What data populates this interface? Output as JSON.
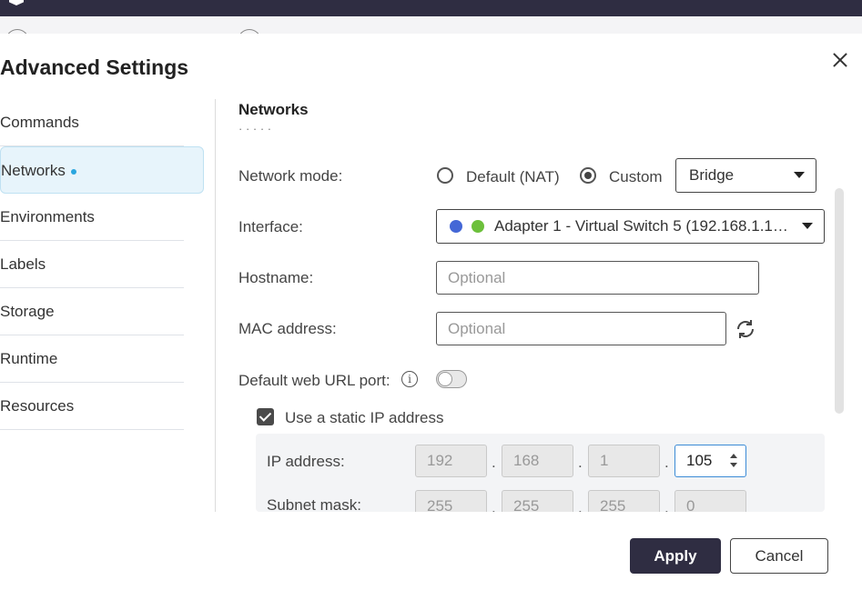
{
  "dialog": {
    "title": "Advanced Settings",
    "section_title": "Networks",
    "section_subtitle_cut": "· · · · ·"
  },
  "sidebar": {
    "items": [
      {
        "label": "Commands"
      },
      {
        "label": "Networks"
      },
      {
        "label": "Environments"
      },
      {
        "label": "Labels"
      },
      {
        "label": "Storage"
      },
      {
        "label": "Runtime"
      },
      {
        "label": "Resources"
      }
    ],
    "active_index": 1
  },
  "network_mode": {
    "label": "Network mode:",
    "option_default": "Default (NAT)",
    "option_custom": "Custom",
    "selected": "Custom",
    "custom_select_value": "Bridge"
  },
  "interface": {
    "label": "Interface:",
    "value": "Adapter 1 - Virtual Switch 5 (192.168.1.1…"
  },
  "hostname": {
    "label": "Hostname:",
    "placeholder": "Optional",
    "value": ""
  },
  "mac_address": {
    "label": "MAC address:",
    "placeholder": "Optional",
    "value": ""
  },
  "web_url_port": {
    "label": "Default web URL port:",
    "enabled": false,
    "info_glyph": "i"
  },
  "static_ip": {
    "label": "Use a static IP address",
    "checked": true,
    "ip_label": "IP address:",
    "ip": [
      "192",
      "168",
      "1",
      "105"
    ],
    "subnet_label": "Subnet mask:",
    "subnet": [
      "255",
      "255",
      "255",
      "0"
    ],
    "separator": "."
  },
  "buttons": {
    "apply": "Apply",
    "cancel": "Cancel"
  },
  "colors": {
    "topbar": "#2f2d42",
    "accent": "#2aa6df",
    "active_bg": "#e7f4fb",
    "apply_bg": "#2f2d42"
  }
}
